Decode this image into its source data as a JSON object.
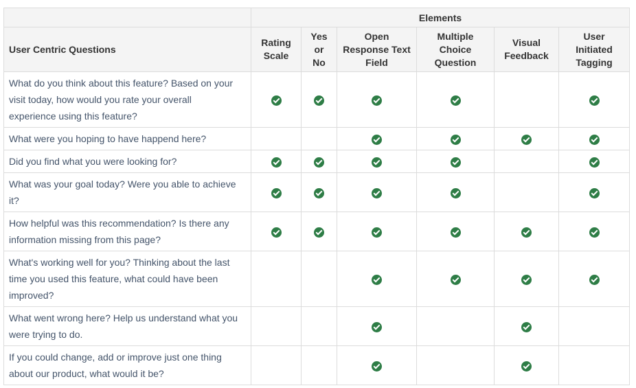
{
  "table": {
    "group_label": "Elements",
    "question_header": "User Centric Questions",
    "columns": [
      [
        "Rating",
        "Scale"
      ],
      [
        "Yes",
        "or",
        "No"
      ],
      [
        "Open",
        "Response Text",
        "Field"
      ],
      [
        "Multiple",
        "Choice",
        "Question"
      ],
      [
        "Visual",
        "Feedback"
      ],
      [
        "User",
        "Initiated",
        "Tagging"
      ]
    ],
    "rows": [
      {
        "question": "What do you think about this feature? Based on your visit today, how would you rate your overall experience using this feature?",
        "checks": [
          true,
          true,
          true,
          true,
          false,
          true
        ]
      },
      {
        "question": "What were you hoping to have happend here?",
        "checks": [
          false,
          false,
          true,
          true,
          true,
          true
        ]
      },
      {
        "question": "Did you find what you were looking for?",
        "checks": [
          true,
          true,
          true,
          true,
          false,
          true
        ]
      },
      {
        "question": "What was your goal today? Were you able to achieve it?",
        "checks": [
          true,
          true,
          true,
          true,
          false,
          true
        ]
      },
      {
        "question": "How helpful was this recommendation? Is there any information missing from this page?",
        "checks": [
          true,
          true,
          true,
          true,
          true,
          true
        ]
      },
      {
        "question": "What's working well for you? Thinking about the last time you used this feature, what could have been improved?",
        "checks": [
          false,
          false,
          true,
          true,
          true,
          true
        ]
      },
      {
        "question": "What went wrong here? Help us understand what you were trying to do.",
        "checks": [
          false,
          false,
          true,
          false,
          true,
          false
        ]
      },
      {
        "question": "If you could change, add or improve just one thing about our product, what would it be?",
        "checks": [
          false,
          false,
          true,
          false,
          true,
          false
        ]
      }
    ],
    "check_icon": "check-circle-icon",
    "check_color": "#2e7d46"
  }
}
